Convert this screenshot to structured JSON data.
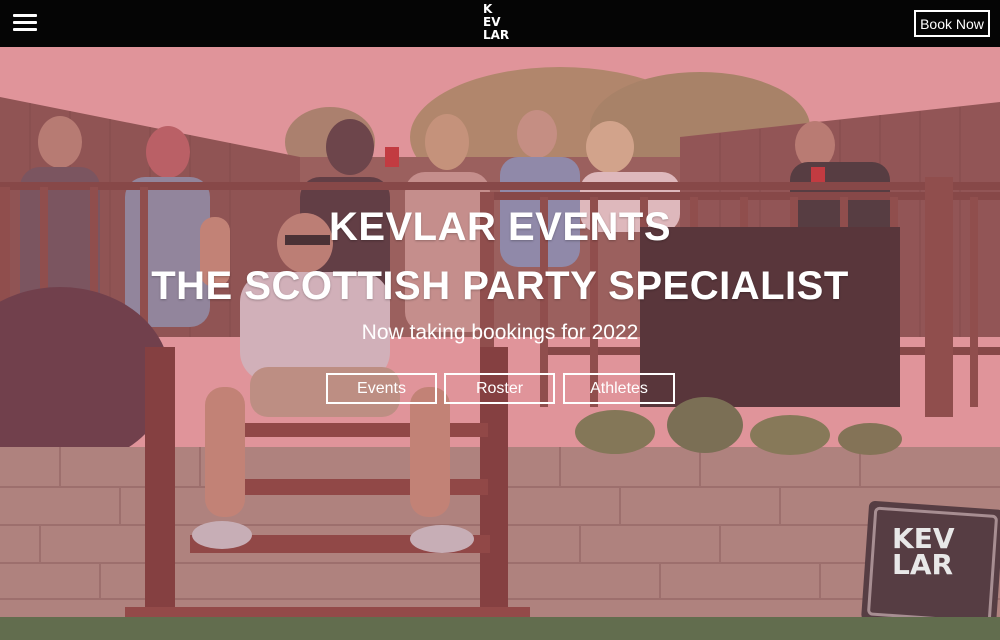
{
  "header": {
    "menu_icon": "hamburger-menu-icon",
    "logo_lines": [
      "K",
      "EV",
      "LAR"
    ],
    "book_now_label": "Book Now"
  },
  "hero": {
    "headline_1": "KEVLAR EVENTS",
    "headline_2": "THE SCOTTISH PARTY SPECIALIST",
    "subline": "Now taking bookings for 2022",
    "buttons": [
      {
        "label": "Events"
      },
      {
        "label": "Roster"
      },
      {
        "label": "Athletes"
      }
    ],
    "case_logo_lines": [
      "KEV",
      "LAR"
    ]
  },
  "colors": {
    "header_bg": "#050505",
    "overlay": "#c8707c",
    "text": "#ffffff"
  }
}
